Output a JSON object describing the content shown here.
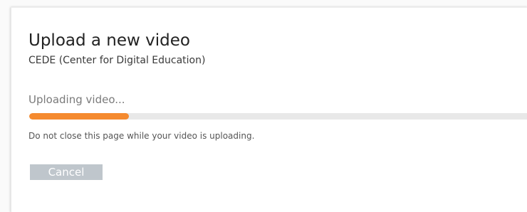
{
  "upload": {
    "title": "Upload a new video",
    "organization": "CEDE (Center for Digital Education)",
    "status_text": "Uploading video...",
    "progress_fraction": 0.2,
    "warning_text": "Do not close this page while your video is uploading.",
    "cancel_label": "Cancel"
  },
  "colors": {
    "progress_fill": "#f58a2f",
    "progress_track": "#e8e8e8",
    "cancel_button": "#bfc6cc"
  }
}
